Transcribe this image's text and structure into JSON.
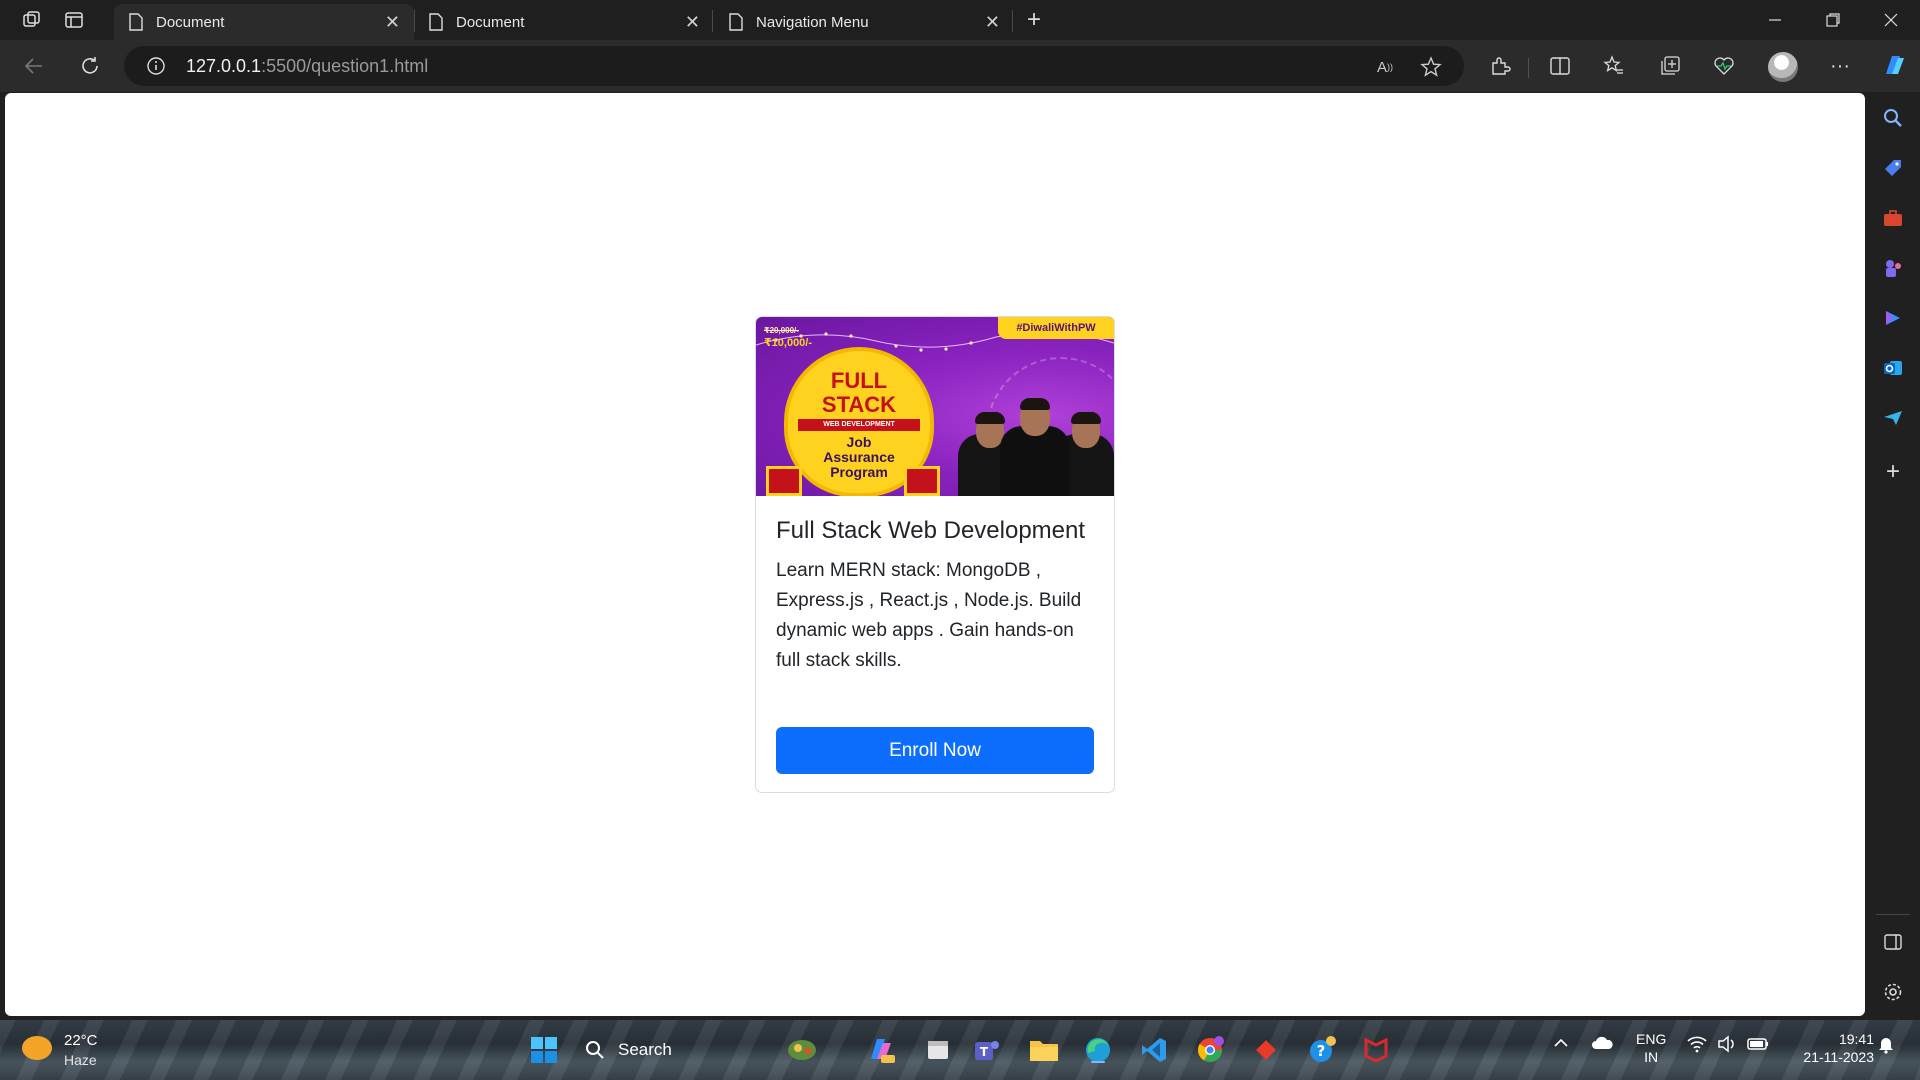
{
  "browser": {
    "tabs": [
      {
        "title": "Document",
        "active": true
      },
      {
        "title": "Document",
        "active": false
      },
      {
        "title": "Navigation Menu",
        "active": false
      }
    ],
    "url_host": "127.0.0.1",
    "url_rest": ":5500/question1.html"
  },
  "card": {
    "banner": {
      "tag": "#DiwaliWithPW",
      "old_price": "₹20,000/-",
      "price": "₹10,000/-",
      "title_line1": "FULL",
      "title_line2": "STACK",
      "strip": "WEB DEVELOPMENT",
      "program_line1": "Job",
      "program_line2": "Assurance",
      "program_line3": "Program"
    },
    "title": "Full Stack Web Development",
    "text": "Learn MERN stack: MongoDB , Express.js , React.js , Node.js. Build dynamic web apps . Gain hands-on full stack skills.",
    "button": "Enroll Now"
  },
  "taskbar": {
    "temperature": "22°C",
    "condition": "Haze",
    "search_label": "Search",
    "lang_line1": "ENG",
    "lang_line2": "IN",
    "time": "19:41",
    "date": "21-11-2023"
  },
  "colors": {
    "primary_button": "#0d6efd",
    "browser_chrome": "#2b2b2b",
    "banner_purple": "#8a23bf",
    "banner_yellow": "#ffd21f"
  }
}
